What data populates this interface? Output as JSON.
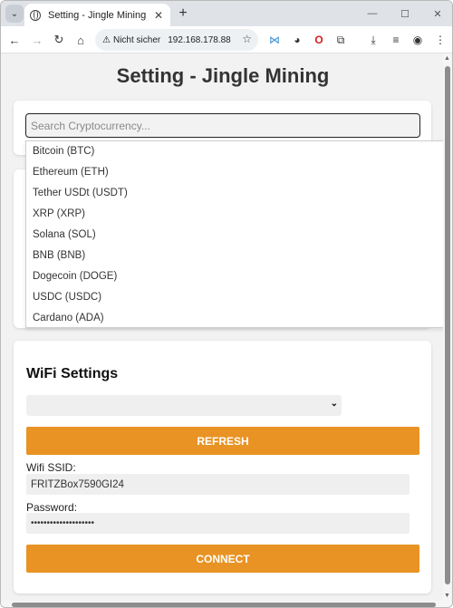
{
  "browser": {
    "tab_title": "Setting - Jingle Mining",
    "security_label": "Nicht sicher",
    "url": "192.168.178.88"
  },
  "page": {
    "title": "Setting - Jingle Mining"
  },
  "search": {
    "placeholder": "Search Cryptocurrency..."
  },
  "dropdown": {
    "items": [
      "Bitcoin (BTC)",
      "Ethereum (ETH)",
      "Tether USDt (USDT)",
      "XRP (XRP)",
      "Solana (SOL)",
      "BNB (BNB)",
      "Dogecoin (DOGE)",
      "USDC (USDC)",
      "Cardano (ADA)"
    ]
  },
  "wifi": {
    "heading": "WiFi Settings",
    "refresh_label": "REFRESH",
    "ssid_label": "Wifi SSID:",
    "ssid_value": "FRITZBox7590GI24",
    "password_label": "Password:",
    "password_value": "••••••••••••••••••••",
    "connect_label": "CONNECT"
  },
  "colors": {
    "accent": "#e89323",
    "page_bg": "#f2f2f2",
    "card_bg": "#ffffff"
  },
  "icons": {
    "tab_favicon": "globe-icon",
    "security": "warning-icon",
    "bookmark": "star-icon"
  }
}
